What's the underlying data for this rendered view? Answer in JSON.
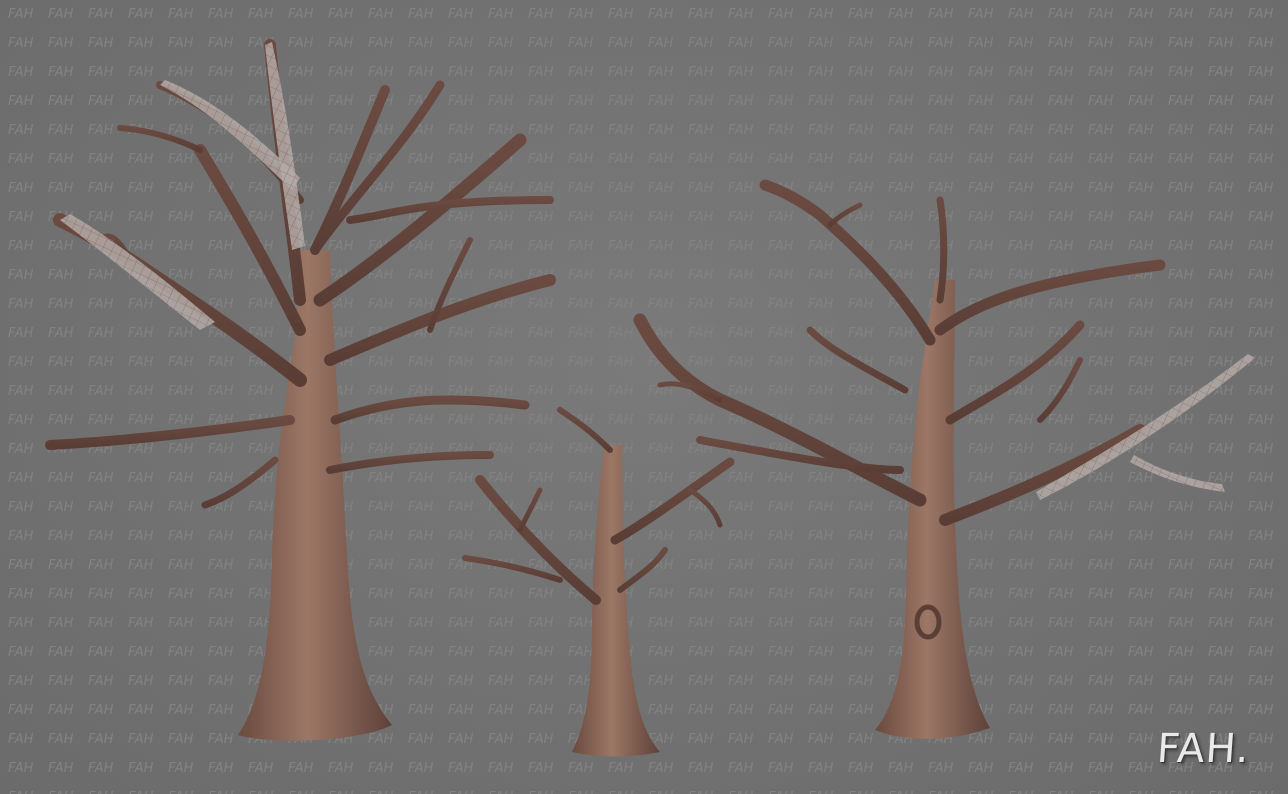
{
  "logo": {
    "text": "FAH."
  },
  "watermark": {
    "text": "FAH",
    "color": "#828282"
  },
  "colors": {
    "background": "#747474",
    "bark_light": "#9c7766",
    "bark_mid": "#7d5a4d",
    "bark_dark": "#5b3f36",
    "wireframe": "#c7c0c0"
  },
  "trees": [
    {
      "name": "large-dead-tree"
    },
    {
      "name": "small-dead-tree"
    },
    {
      "name": "wide-dead-tree"
    }
  ]
}
